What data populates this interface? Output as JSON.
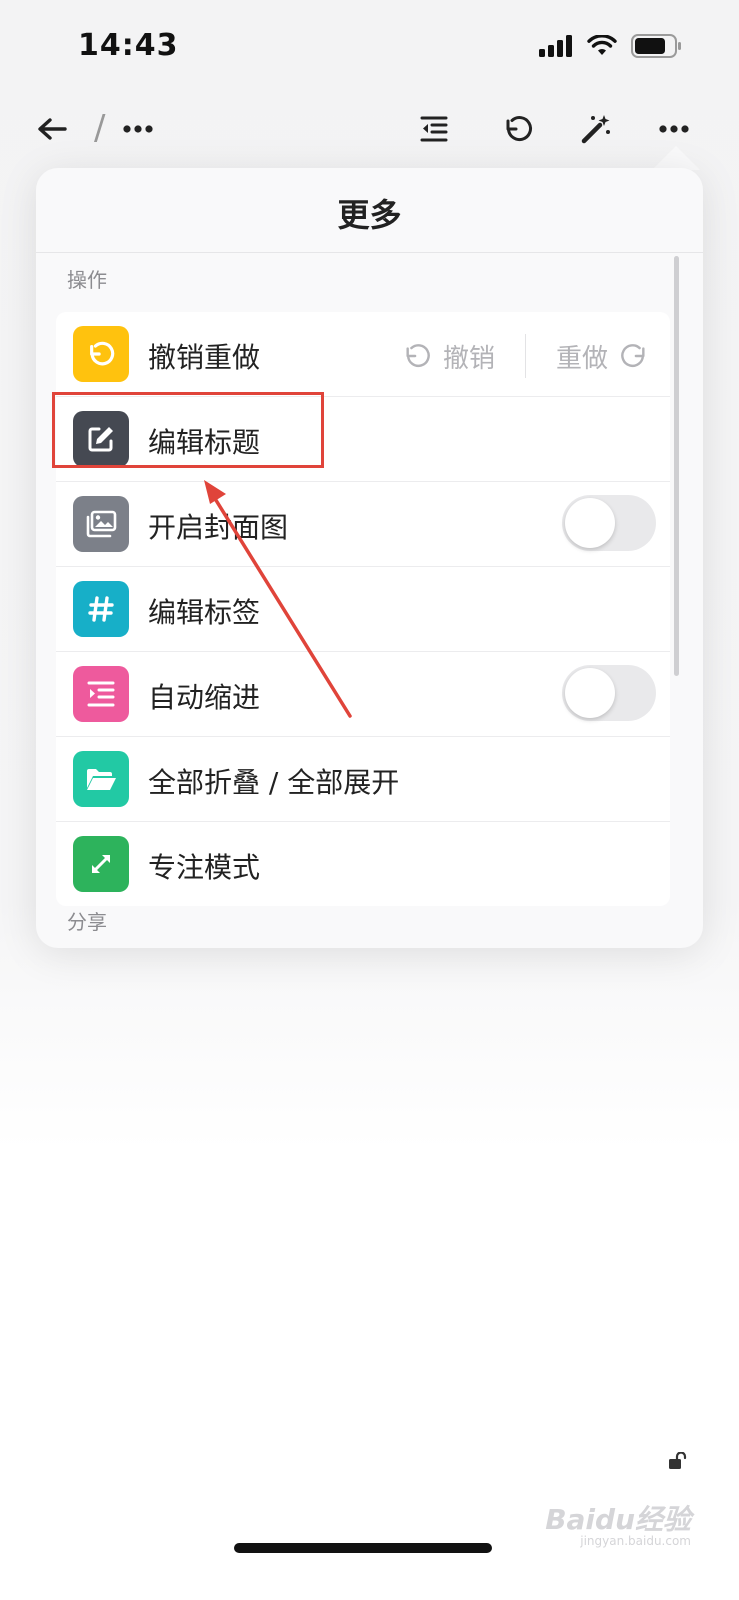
{
  "status_bar": {
    "time": "14:43"
  },
  "toolbar": {
    "breadcrumb_separator": "/"
  },
  "popover": {
    "title": "更多",
    "section_actions": "操作",
    "section_share": "分享",
    "items": [
      {
        "label": "撤销重做",
        "icon": "undo-icon",
        "color": "#FFC20E",
        "undo_label": "撤销",
        "redo_label": "重做"
      },
      {
        "label": "编辑标题",
        "icon": "edit-icon",
        "color": "#454952"
      },
      {
        "label": "开启封面图",
        "icon": "image-icon",
        "color": "#7C8089",
        "toggle_on": false
      },
      {
        "label": "编辑标签",
        "icon": "hash-icon",
        "color": "#17AFC8"
      },
      {
        "label": "自动缩进",
        "icon": "indent-icon",
        "color": "#EE5A9D",
        "toggle_on": false
      },
      {
        "label": "全部折叠 / 全部展开",
        "icon": "folder-icon",
        "color": "#22C9A4"
      },
      {
        "label": "专注模式",
        "icon": "expand-icon",
        "color": "#2DB35C"
      }
    ]
  },
  "annotation": {
    "highlight_color": "#E0443A"
  },
  "watermark": {
    "text": "Baidu经验",
    "sub": "jingyan.baidu.com"
  }
}
